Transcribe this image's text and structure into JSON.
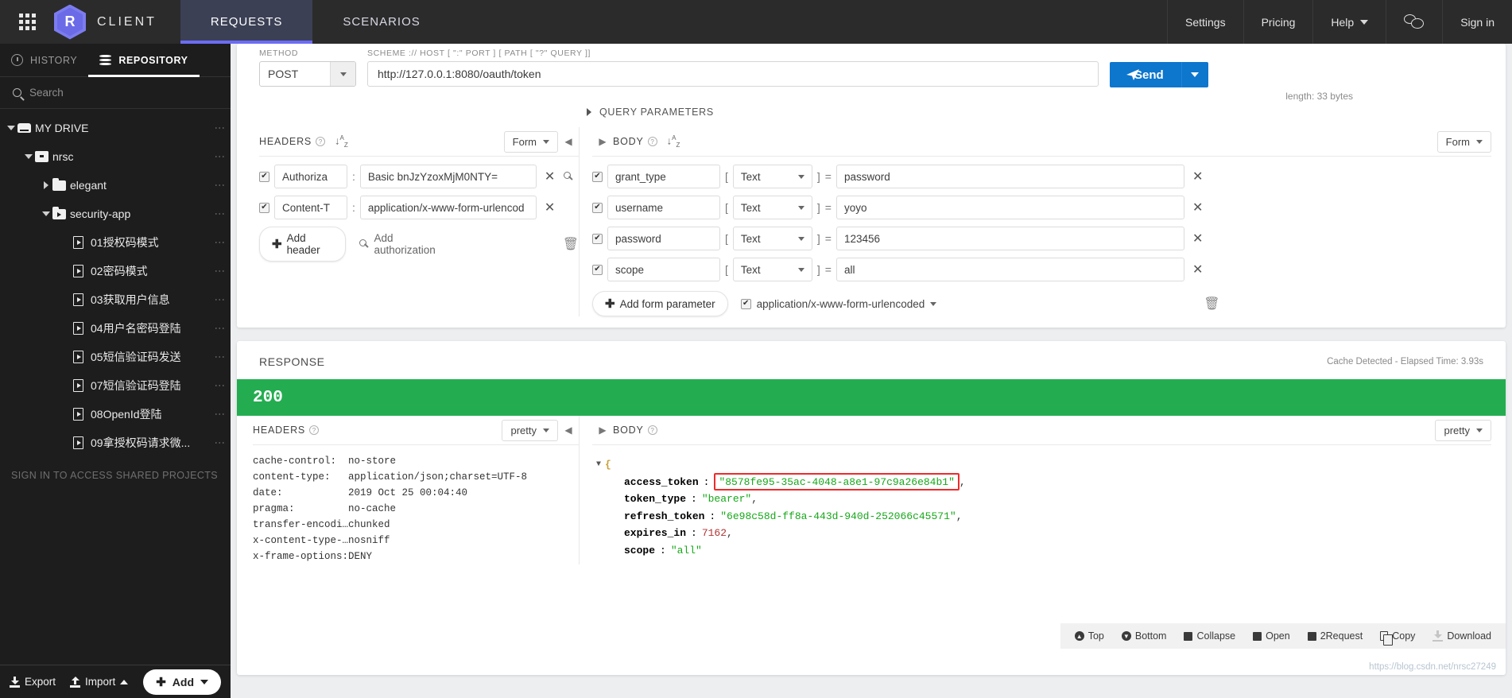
{
  "topbar": {
    "brand": "CLIENT",
    "logo_letter": "R",
    "tabs": [
      {
        "label": "REQUESTS",
        "active": true
      },
      {
        "label": "SCENARIOS",
        "active": false
      }
    ],
    "right_items": [
      {
        "label": "Settings"
      },
      {
        "label": "Pricing"
      },
      {
        "label": "Help"
      },
      {
        "label": "Sign in"
      }
    ]
  },
  "sidebar": {
    "tabs": [
      {
        "label": "HISTORY",
        "icon": "clock-icon",
        "active": false
      },
      {
        "label": "REPOSITORY",
        "icon": "database-icon",
        "active": true
      }
    ],
    "search_placeholder": "Search",
    "tree": [
      {
        "label": "MY DRIVE",
        "level": 0,
        "icon": "drive-icon",
        "arrow": "down"
      },
      {
        "label": "nrsc",
        "level": 1,
        "icon": "box-icon",
        "arrow": "down"
      },
      {
        "label": "elegant",
        "level": 2,
        "icon": "folder-icon",
        "arrow": "right"
      },
      {
        "label": "security-app",
        "level": 2,
        "icon": "folder-play-icon",
        "arrow": "down"
      },
      {
        "label": "01授权码模式",
        "level": 3,
        "icon": "file-icon",
        "arrow": "none"
      },
      {
        "label": "02密码模式",
        "level": 3,
        "icon": "file-icon",
        "arrow": "none"
      },
      {
        "label": "03获取用户信息",
        "level": 3,
        "icon": "file-icon",
        "arrow": "none"
      },
      {
        "label": "04用户名密码登陆",
        "level": 3,
        "icon": "file-icon",
        "arrow": "none"
      },
      {
        "label": "05短信验证码发送",
        "level": 3,
        "icon": "file-icon",
        "arrow": "none"
      },
      {
        "label": "07短信验证码登陆",
        "level": 3,
        "icon": "file-icon",
        "arrow": "none"
      },
      {
        "label": "08OpenId登陆",
        "level": 3,
        "icon": "file-icon",
        "arrow": "none"
      },
      {
        "label": "09拿授权码请求微...",
        "level": 3,
        "icon": "file-icon",
        "arrow": "none"
      }
    ],
    "shared_note": "SIGN IN TO ACCESS SHARED PROJECTS",
    "footer": {
      "export": "Export",
      "import": "Import",
      "add": "Add"
    }
  },
  "request": {
    "method_label": "METHOD",
    "method_value": "POST",
    "url_label": "SCHEME :// HOST [ \":\" PORT ] [ PATH [ \"?\" QUERY ]]",
    "url_value": "http://127.0.0.1:8080/oauth/token",
    "send_label": "Send",
    "length_note": "length: 33 bytes",
    "query_parameters": "QUERY PARAMETERS",
    "headers": {
      "title": "HEADERS",
      "mode": "Form",
      "rows": [
        {
          "checked": true,
          "key": "Authoriza",
          "value": "Basic bnJzYzoxMjM0NTY="
        },
        {
          "checked": true,
          "key": "Content-T",
          "value": "application/x-www-form-urlencod"
        }
      ],
      "add_header": "Add header",
      "add_authorization": "Add authorization"
    },
    "body": {
      "title": "BODY",
      "mode": "Form",
      "rows": [
        {
          "checked": true,
          "key": "grant_type",
          "type": "Text",
          "value": "password"
        },
        {
          "checked": true,
          "key": "username",
          "type": "Text",
          "value": "yoyo"
        },
        {
          "checked": true,
          "key": "password",
          "type": "Text",
          "value": "123456"
        },
        {
          "checked": true,
          "key": "scope",
          "type": "Text",
          "value": "all"
        }
      ],
      "add_form_parameter": "Add form parameter",
      "content_type": "application/x-www-form-urlencoded"
    }
  },
  "response": {
    "title": "RESPONSE",
    "cache_note": "Cache Detected - Elapsed Time: 3.93s",
    "status_code": "200",
    "headers": {
      "title": "HEADERS",
      "mode": "pretty",
      "rows": [
        {
          "key": "cache-control:",
          "value": "no-store"
        },
        {
          "key": "content-type:",
          "value": "application/json;charset=UTF-8"
        },
        {
          "key": "date:",
          "value": "2019 Oct 25 00:04:40"
        },
        {
          "key": "pragma:",
          "value": "no-cache"
        },
        {
          "key": "transfer-encodi…",
          "value": "chunked"
        },
        {
          "key": "x-content-type-…",
          "value": "nosniff"
        },
        {
          "key": "x-frame-options:",
          "value": "DENY"
        }
      ]
    },
    "body": {
      "title": "BODY",
      "mode": "pretty",
      "open_brace": "{",
      "fields": [
        {
          "key": "access_token",
          "value": "\"8578fe95-35ac-4048-a8e1-97c9a26e84b1\"",
          "comma": ",",
          "kind": "string",
          "highlight": true
        },
        {
          "key": "token_type",
          "value": "\"bearer\"",
          "comma": ",",
          "kind": "string",
          "highlight": false
        },
        {
          "key": "refresh_token",
          "value": "\"6e98c58d-ff8a-443d-940d-252066c45571\"",
          "comma": ",",
          "kind": "string",
          "highlight": false
        },
        {
          "key": "expires_in",
          "value": "7162",
          "comma": ",",
          "kind": "number",
          "highlight": false
        },
        {
          "key": "scope",
          "value": "\"all\"",
          "comma": "",
          "kind": "string",
          "highlight": false
        }
      ]
    },
    "toolbar": [
      {
        "label": "Top",
        "icon": "arrow-up-circle-icon"
      },
      {
        "label": "Bottom",
        "icon": "arrow-down-circle-icon"
      },
      {
        "label": "Collapse",
        "icon": "minus-square-icon"
      },
      {
        "label": "Open",
        "icon": "open-square-icon"
      },
      {
        "label": "2Request",
        "icon": "request-icon"
      },
      {
        "label": "Copy",
        "icon": "copy-icon"
      },
      {
        "label": "Download",
        "icon": "download-icon"
      }
    ],
    "watermark": "https://blog.csdn.net/nrsc27249"
  }
}
